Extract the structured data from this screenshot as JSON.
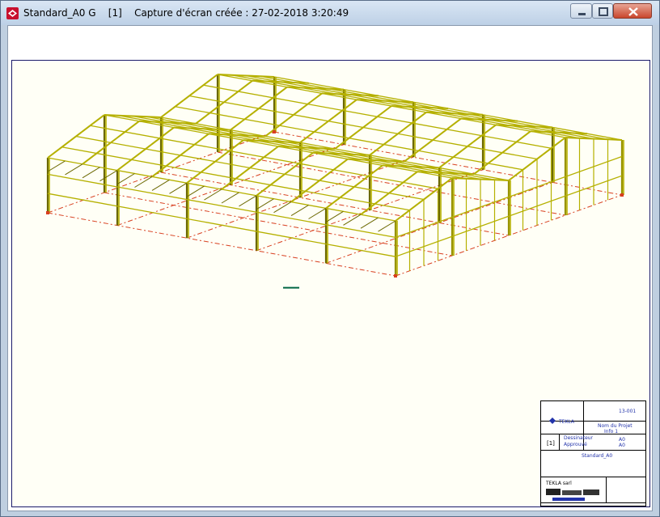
{
  "window": {
    "title": "Standard_A0 G    [1]    Capture d'écran créée : 27-02-2018 3:20:49",
    "app_icon": "tekla-app-icon",
    "controls": [
      "minimize-icon",
      "maximize-icon",
      "close-icon"
    ]
  },
  "viewport": {
    "content": "3d-steel-frame-model",
    "colors": {
      "frame": "#b5b000",
      "frame_dark": "#6b6800",
      "grid_lines": "#d84020",
      "background": "#fffff6"
    }
  },
  "cartouche": {
    "drawing_number": "13-001",
    "project_label": "Nom du Projet",
    "project_info": "Info 1",
    "sheet_mark": "[1]",
    "designer_label": "Dessinateur",
    "approved_label": "Approuvé",
    "revision": "A0",
    "revision_id": "A0",
    "name": "Standard_A0",
    "brand": "TEKLA",
    "footer_text": "TEKLA sarl"
  }
}
